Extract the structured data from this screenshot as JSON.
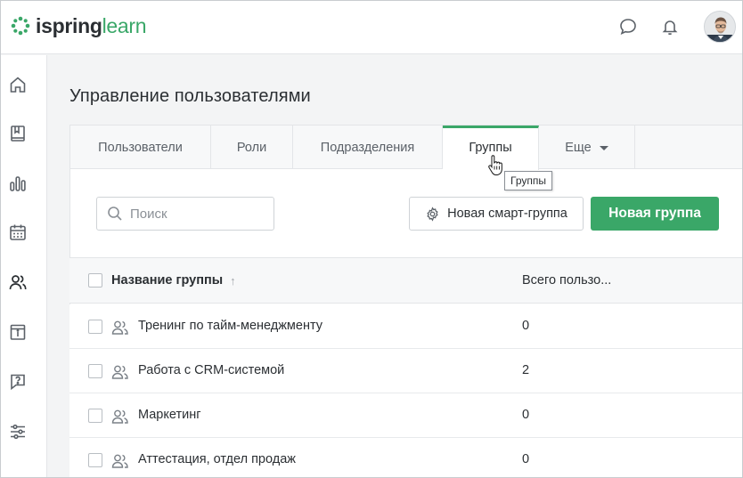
{
  "brand": {
    "part1": "ispring",
    "part2": "learn",
    "accent": "#3aa768"
  },
  "header": {
    "chat_icon": "chat-bubble-icon",
    "bell_icon": "bell-icon",
    "avatar": "user-avatar"
  },
  "sidebar": {
    "items": [
      {
        "icon": "home-icon"
      },
      {
        "icon": "book-icon"
      },
      {
        "icon": "bar-chart-icon"
      },
      {
        "icon": "calendar-icon"
      },
      {
        "icon": "users-icon",
        "active": true
      },
      {
        "icon": "info-card-icon"
      },
      {
        "icon": "question-chat-icon"
      },
      {
        "icon": "sliders-icon"
      }
    ]
  },
  "page": {
    "title": "Управление пользователями"
  },
  "tabs": [
    {
      "label": "Пользователи"
    },
    {
      "label": "Роли"
    },
    {
      "label": "Подразделения"
    },
    {
      "label": "Группы",
      "active": true
    },
    {
      "label": "Еще"
    }
  ],
  "tooltip": {
    "text": "Группы"
  },
  "toolbar": {
    "search_placeholder": "Поиск",
    "smart_group_label": "Новая смарт-группа",
    "new_group_label": "Новая группа"
  },
  "table": {
    "col_name": "Название группы",
    "col_total": "Всего пользо...",
    "rows": [
      {
        "name": "Тренинг по тайм-менеджменту",
        "count": "0"
      },
      {
        "name": "Работа с CRM-системой",
        "count": "2"
      },
      {
        "name": "Маркетинг",
        "count": "0"
      },
      {
        "name": "Аттестация, отдел продаж",
        "count": "0"
      }
    ]
  }
}
